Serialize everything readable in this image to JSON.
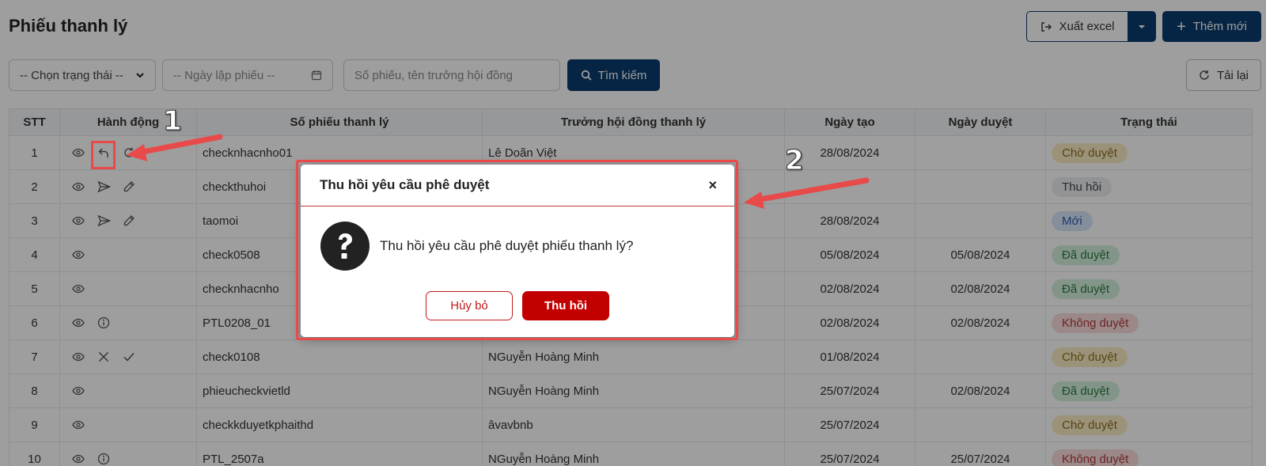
{
  "page": {
    "title": "Phiếu thanh lý"
  },
  "toolbar": {
    "export_label": "Xuất excel",
    "add_label": "Thêm mới",
    "reload_label": "Tải lại"
  },
  "filters": {
    "status_value": "-- Chọn trạng thái --",
    "date_placeholder": "-- Ngày lập phiếu --",
    "search_placeholder": "Số phiếu, tên trưởng hội đồng",
    "search_button": "Tìm kiếm"
  },
  "table": {
    "headers": [
      "STT",
      "Hành động",
      "Số phiếu thanh lý",
      "Trưởng hội đồng thanh lý",
      "Ngày tạo",
      "Ngày duyệt",
      "Trạng thái"
    ],
    "rows": [
      {
        "stt": "1",
        "actions": [
          "eye-icon",
          "undo-icon",
          "refresh-icon"
        ],
        "code": "checknhacnho01",
        "chair": "Lê Doãn Việt",
        "created": "28/08/2024",
        "approved": "",
        "status": "Chờ duyệt"
      },
      {
        "stt": "2",
        "actions": [
          "eye-icon",
          "send-icon",
          "edit-icon"
        ],
        "code": "checkthuhoi",
        "chair": "",
        "created": "",
        "approved": "",
        "status": "Thu hồi"
      },
      {
        "stt": "3",
        "actions": [
          "eye-icon",
          "send-icon",
          "edit-icon"
        ],
        "code": "taomoi",
        "chair": "",
        "created": "28/08/2024",
        "approved": "",
        "status": "Mới"
      },
      {
        "stt": "4",
        "actions": [
          "eye-icon"
        ],
        "code": "check0508",
        "chair": "",
        "created": "05/08/2024",
        "approved": "05/08/2024",
        "status": "Đã duyệt"
      },
      {
        "stt": "5",
        "actions": [
          "eye-icon"
        ],
        "code": "checknhacnho",
        "chair": "",
        "created": "02/08/2024",
        "approved": "02/08/2024",
        "status": "Đã duyệt"
      },
      {
        "stt": "6",
        "actions": [
          "eye-icon",
          "info-icon"
        ],
        "code": "PTL0208_01",
        "chair": "",
        "created": "02/08/2024",
        "approved": "02/08/2024",
        "status": "Không duyệt"
      },
      {
        "stt": "7",
        "actions": [
          "eye-icon",
          "close-icon",
          "check-icon"
        ],
        "code": "check0108",
        "chair": "NGuyễn Hoàng Minh",
        "created": "01/08/2024",
        "approved": "",
        "status": "Chờ duyệt"
      },
      {
        "stt": "8",
        "actions": [
          "eye-icon"
        ],
        "code": "phieucheckvietld",
        "chair": "NGuyễn Hoàng Minh",
        "created": "25/07/2024",
        "approved": "02/08/2024",
        "status": "Đã duyệt"
      },
      {
        "stt": "9",
        "actions": [
          "eye-icon"
        ],
        "code": "checkkduyetkphaithd",
        "chair": "âvavbnb",
        "created": "25/07/2024",
        "approved": "",
        "status": "Chờ duyệt"
      },
      {
        "stt": "10",
        "actions": [
          "eye-icon",
          "info-icon"
        ],
        "code": "PTL_2507a",
        "chair": "NGuyễn Hoàng Minh",
        "created": "25/07/2024",
        "approved": "25/07/2024",
        "status": "Không duyệt"
      }
    ]
  },
  "status_colors": {
    "Chờ duyệt": {
      "bg": "#fbeec4",
      "fg": "#8a6d1c"
    },
    "Thu hồi": {
      "bg": "#eceef1",
      "fg": "#444"
    },
    "Mới": {
      "bg": "#d7e6fb",
      "fg": "#2b5ea8"
    },
    "Đã duyệt": {
      "bg": "#d3f0dc",
      "fg": "#2d7a45"
    },
    "Không duyệt": {
      "bg": "#fbdbdb",
      "fg": "#b03a3a"
    }
  },
  "modal": {
    "title": "Thu hồi yêu cầu phê duyệt",
    "close": "×",
    "message": "Thu hồi yêu cầu phê duyệt phiếu thanh lý?",
    "cancel_label": "Hủy bỏ",
    "confirm_label": "Thu hồi"
  },
  "annotations": {
    "marker1": "1",
    "marker2": "2"
  },
  "colors": {
    "primary": "#0b3c6e",
    "danger": "#c30000",
    "annotation": "#e84a4a"
  }
}
